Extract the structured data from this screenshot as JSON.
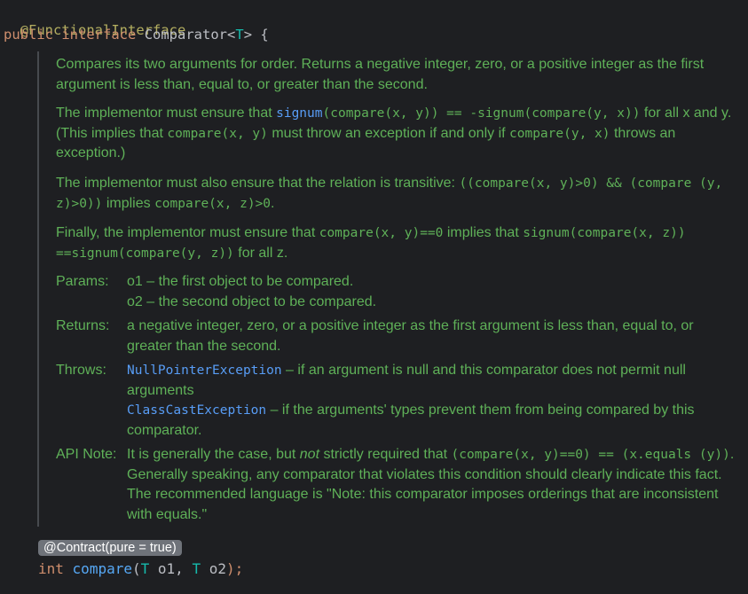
{
  "header": {
    "annotation": "@FunctionalInterface",
    "kw_public": "public",
    "kw_interface": "interface",
    "name": "Comparator",
    "lt": "<",
    "type_param": "T",
    "gt_brace": "> {"
  },
  "doc": {
    "p1": "Compares its two arguments for order. Returns a negative integer, zero, or a positive integer as the first argument is less than, equal to, or greater than the second.",
    "p2": {
      "a": "The implementor must ensure that ",
      "code1_fn": "signum",
      "code1_rest": "(compare(x, y)) == -signum(compare(y, x))",
      "b": " for all x and y. (This implies that ",
      "code2": "compare(x, y)",
      "c": " must throw an exception if and only if ",
      "code3": "compare(y, x)",
      "d": " throws an exception.)"
    },
    "p3": {
      "a": "The implementor must also ensure that the relation is transitive: ",
      "code1": "((compare(x, y)>0) && (compare (y, z)>0))",
      "b": " implies ",
      "code2": "compare(x, z)>0",
      "c": "."
    },
    "p4": {
      "a": "Finally, the implementor must ensure that ",
      "code1": "compare(x, y)==0",
      "b": " implies that ",
      "code2": "signum(compare(x, z)) ==signum(compare(y, z))",
      "c": " for all z."
    },
    "params": {
      "label": "Params:",
      "o1_name": "o1",
      "o1_desc": " – the first object to be compared.",
      "o2_name": "o2",
      "o2_desc": " – the second object to be compared."
    },
    "returns": {
      "label": "Returns:",
      "text": "a negative integer, zero, or a positive integer as the first argument is less than, equal to, or greater than the second."
    },
    "throws": {
      "label": "Throws:",
      "ex1": "NullPointerException",
      "ex1_desc": " – if an argument is null and this comparator does not permit null arguments",
      "ex2": "ClassCastException",
      "ex2_desc": " – if the arguments' types prevent them from being compared by this comparator."
    },
    "api_note": {
      "label": "API Note:",
      "a": "It is generally the case, but ",
      "em": "not",
      "b": " strictly required that ",
      "code1": "(compare(x, y)==0) == (x.equals (y))",
      "c": ". Generally speaking, any comparator that violates this condition should clearly indicate this fact. The recommended language is \"Note: this comparator imposes orderings that are inconsistent with equals.\""
    }
  },
  "contract_badge": "@Contract(pure = true)",
  "signature": {
    "kw_int": "int",
    "method": "compare",
    "open": "(",
    "t1": "T",
    "p1": " o1, ",
    "t2": "T",
    "p2": " o2",
    "close": ");"
  },
  "colors": {
    "background": "#1e1f22",
    "doc_text": "#5fb158",
    "keyword": "#cf8e6d",
    "annotation": "#b3ae60",
    "link": "#589df6"
  }
}
